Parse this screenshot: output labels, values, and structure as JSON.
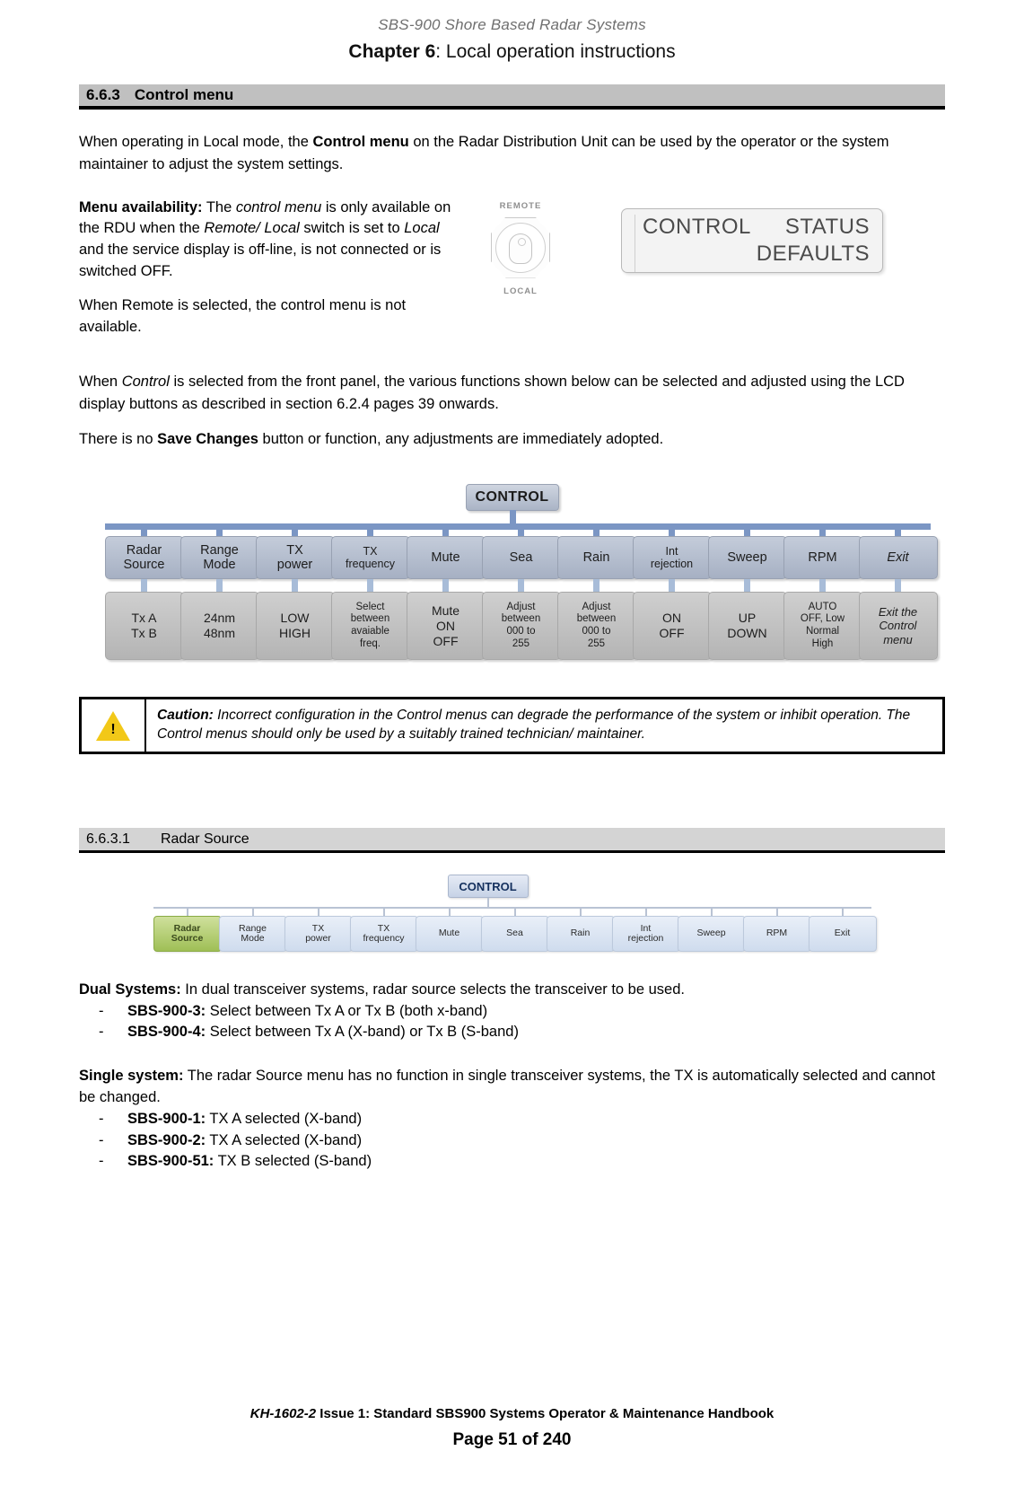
{
  "header": {
    "doc_title": "SBS-900 Shore Based Radar Systems",
    "chapter_label": "Chapter 6",
    "chapter_title": ": Local operation instructions"
  },
  "section": {
    "number": "6.6.3",
    "title": "Control menu"
  },
  "intro": {
    "p1_a": "When operating in Local mode, the ",
    "p1_b": "Control menu",
    "p1_c": " on the Radar Distribution Unit can be used by the operator or the system maintainer to adjust the system settings."
  },
  "availability": {
    "label": "Menu availability:",
    "t1": " The ",
    "i1": "control menu",
    "t2": " is only available on the RDU when the ",
    "i2": "Remote/ Local",
    "t3": " switch is set to ",
    "i3": "Local",
    "t4": " and the service display is off-line, is not connected or is switched OFF.",
    "p2": "When Remote is selected, the control menu is not available."
  },
  "switch_figure": {
    "top_label": "REMOTE",
    "bottom_label": "LOCAL"
  },
  "lcd_panel": {
    "left": "CONTROL",
    "right": "STATUS",
    "second": "DEFAULTS"
  },
  "control_para": {
    "a": "When ",
    "i": "Control",
    "b": " is selected from the front panel, the various functions shown below can be selected and adjusted using the LCD display buttons as described in section 6.2.4 pages 39 onwards."
  },
  "save_para": {
    "a": "There is no ",
    "b": "Save Changes",
    "c": " button or function, any adjustments are immediately adopted."
  },
  "flow": {
    "root": "CONTROL",
    "nodes": [
      {
        "label": "Radar\nSource",
        "leaf": "Tx A\nTx B",
        "small": false,
        "leaf_small": false
      },
      {
        "label": "Range\nMode",
        "leaf": "24nm\n48nm",
        "small": false,
        "leaf_small": false
      },
      {
        "label": "TX\npower",
        "leaf": "LOW\nHIGH",
        "small": false,
        "leaf_small": false
      },
      {
        "label": "TX\nfrequency",
        "leaf": "Select\nbetween\navaiable\nfreq.",
        "small": true,
        "leaf_small": true
      },
      {
        "label": "Mute",
        "leaf": "Mute\nON\nOFF",
        "small": false,
        "leaf_small": false
      },
      {
        "label": "Sea",
        "leaf": "Adjust\nbetween\n000 to\n255",
        "small": false,
        "leaf_small": true
      },
      {
        "label": "Rain",
        "leaf": "Adjust\nbetween\n000 to\n255",
        "small": false,
        "leaf_small": true
      },
      {
        "label": "Int\nrejection",
        "leaf": "ON\nOFF",
        "small": true,
        "leaf_small": false
      },
      {
        "label": "Sweep",
        "leaf": "UP\nDOWN",
        "small": false,
        "leaf_small": false
      },
      {
        "label": "RPM",
        "leaf": "AUTO\nOFF, Low\nNormal\nHigh",
        "small": false,
        "leaf_small": true
      },
      {
        "label": "Exit",
        "leaf": "Exit the\nControl\nmenu",
        "small": false,
        "leaf_small": false
      }
    ]
  },
  "caution": {
    "label": "Caution:",
    "text": " Incorrect configuration in the Control menus can degrade the performance of the system or inhibit operation. The Control menus should only be used by a suitably trained technician/ maintainer."
  },
  "subsection": {
    "number": "6.6.3.1",
    "title": "Radar Source"
  },
  "miniflow": {
    "root": "CONTROL",
    "nodes": [
      "Radar\nSource",
      "Range\nMode",
      "TX\npower",
      "TX\nfrequency",
      "Mute",
      "Sea",
      "Rain",
      "Int\nrejection",
      "Sweep",
      "RPM",
      "Exit"
    ],
    "highlighted_index": 0
  },
  "dual": {
    "label": "Dual Systems:",
    "text": " In dual transceiver systems, radar source selects the transceiver to be used.",
    "items": [
      {
        "dash": "-",
        "model": "SBS-900-3:",
        "desc": " Select between Tx A or Tx B (both x-band)"
      },
      {
        "dash": "-",
        "model": "SBS-900-4:",
        "desc": " Select between Tx A (X-band) or Tx B (S-band)"
      }
    ]
  },
  "single": {
    "label": "Single system:",
    "text": " The radar Source menu has no function in single transceiver systems, the TX is automatically selected and cannot be changed.",
    "items": [
      {
        "dash": "-",
        "model": "SBS-900-1:",
        "desc": " TX A selected (X-band)"
      },
      {
        "dash": "-",
        "model": "SBS-900-2:",
        "desc": " TX A selected (X-band)"
      },
      {
        "dash": "-",
        "model": "SBS-900-51:",
        "desc": " TX B selected (S-band)"
      }
    ]
  },
  "footer": {
    "doc_ref": "KH-1602-2",
    "issue": " Issue 1: Standard SBS900 Systems Operator & Maintenance Handbook",
    "page": "Page 51 of 240"
  },
  "colors": {
    "section_bar": "#c0c0c0",
    "subsection_bar": "#d4d4d4",
    "flow_connector": "#7b96c4",
    "flow_node": "#b5bfd0",
    "flow_leaf": "#c2c2c2",
    "caution_icon": "#f2c818",
    "highlight_green": "#9fbf56"
  }
}
